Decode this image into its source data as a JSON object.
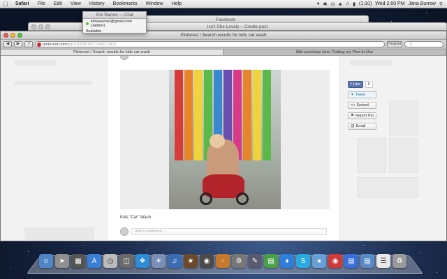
{
  "menubar": {
    "app": "Safari",
    "items": [
      "File",
      "Edit",
      "View",
      "History",
      "Bookmarks",
      "Window",
      "Help"
    ],
    "battery": "(1:10)",
    "clock": "Wed 2:00 PM",
    "user": "Jana Burrow"
  },
  "windows": {
    "chat_title": "Kim Warren — Chat",
    "chat_account": "kimawarren@gmail.com (Jabber)",
    "chat_status": "Available",
    "facebook_title": "Facebook",
    "blog_title": "Isn't She Lovely – Create post",
    "safari_title": "Pinterest / Search results for kids car wash"
  },
  "toolbar": {
    "url_host": "pinterest.com",
    "url_path": "/pin/102387697734017367/",
    "reader_label": "Reader"
  },
  "tabs": [
    {
      "label": "Pinterest / Search results for kids car wash"
    },
    {
      "label": "little penelope lane: Putting my Pins to Use"
    }
  ],
  "pin": {
    "caption": "Kids \"Car\" Wash",
    "comment_placeholder": "Add a comment..."
  },
  "actions": {
    "like": "Like",
    "like_count": "0",
    "tweet": "Tweet",
    "embed": "Embed",
    "report": "Report Pin",
    "email": "Email"
  },
  "colors": {
    "pinterest_red": "#c8232c",
    "facebook_blue": "#5f78ab"
  }
}
